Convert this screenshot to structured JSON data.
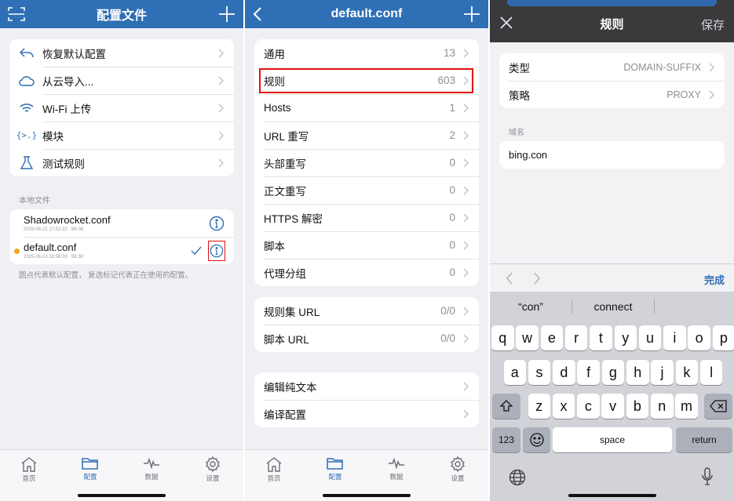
{
  "panel1": {
    "title": "配置文件",
    "actions": [
      {
        "label": "恢复默认配置",
        "icon": "undo-icon"
      },
      {
        "label": "从云导入...",
        "icon": "cloud-icon"
      },
      {
        "label": "Wi-Fi 上传",
        "icon": "wifi-icon"
      },
      {
        "label": "模块",
        "icon": "module-icon"
      },
      {
        "label": "测试规则",
        "icon": "flask-icon"
      }
    ],
    "local_files_label": "本地文件",
    "files": [
      {
        "name": "Shadowrocket.conf",
        "meta": "2025-08-22 17:52:22 · 86.0K"
      },
      {
        "name": "default.conf",
        "meta": "2025-06-13 18:56:39 · 98.3K"
      }
    ],
    "footnote": "圆点代表默认配置， 复选标记代表正在使用的配置。"
  },
  "panel2": {
    "title": "default.conf",
    "group1": [
      {
        "label": "通用",
        "value": "13"
      },
      {
        "label": "规则",
        "value": "603"
      },
      {
        "label": "Hosts",
        "value": "1"
      },
      {
        "label": "URL 重写",
        "value": "2"
      },
      {
        "label": "头部重写",
        "value": "0"
      },
      {
        "label": "正文重写",
        "value": "0"
      },
      {
        "label": "HTTPS 解密",
        "value": "0"
      },
      {
        "label": "脚本",
        "value": "0"
      },
      {
        "label": "代理分组",
        "value": "0"
      }
    ],
    "group2": [
      {
        "label": "规则集 URL",
        "value": "0/0"
      },
      {
        "label": "脚本 URL",
        "value": "0/0"
      }
    ],
    "group3": [
      {
        "label": "编辑纯文本"
      },
      {
        "label": "编译配置"
      }
    ]
  },
  "tabs": [
    {
      "label": "首页",
      "icon": "home-icon"
    },
    {
      "label": "配置",
      "icon": "folder-icon"
    },
    {
      "label": "数据",
      "icon": "activity-icon"
    },
    {
      "label": "设置",
      "icon": "gear-icon"
    }
  ],
  "panel3": {
    "title": "规则",
    "save_label": "保存",
    "type_label": "类型",
    "type_value": "DOMAIN-SUFFIX",
    "policy_label": "策略",
    "policy_value": "PROXY",
    "domain_section_label": "域名",
    "domain_value": "bing.con",
    "done_label": "完成",
    "suggestions": [
      "“con”",
      "connect"
    ],
    "kb_row1": [
      "q",
      "w",
      "e",
      "r",
      "t",
      "y",
      "u",
      "i",
      "o",
      "p"
    ],
    "kb_row2": [
      "a",
      "s",
      "d",
      "f",
      "g",
      "h",
      "j",
      "k",
      "l"
    ],
    "kb_row3": [
      "z",
      "x",
      "c",
      "v",
      "b",
      "n",
      "m"
    ],
    "key_123": "123",
    "key_space": "space",
    "key_return": "return"
  },
  "colors": {
    "accent": "#2f6fb5",
    "highlight": "#e01010",
    "dot": "#f5a623",
    "nav_dark": "#3a3a3c"
  }
}
